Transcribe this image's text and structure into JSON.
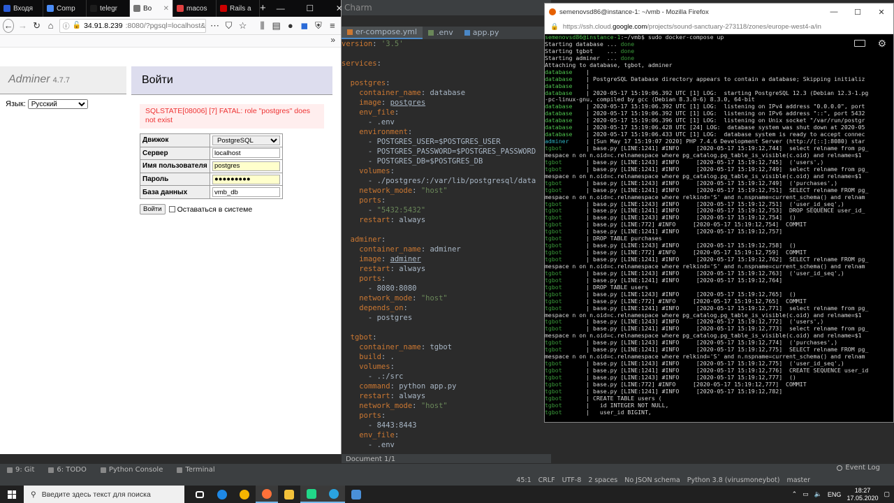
{
  "ide": {
    "title": "Charm",
    "tabs": [
      {
        "label": "er-compose.yml",
        "color": "#cc7832"
      },
      {
        "label": ".env",
        "color": "#6a8759"
      },
      {
        "label": "app.py",
        "color": "#4a88c7"
      }
    ],
    "code": [
      [
        [
          "k",
          "version"
        ],
        [
          "v",
          ": "
        ],
        [
          "s",
          "'3.5'"
        ]
      ],
      [],
      [
        [
          "k",
          "services"
        ],
        [
          "v",
          ":"
        ]
      ],
      [],
      [
        [
          "v",
          "  "
        ],
        [
          "k",
          "postgres"
        ],
        [
          "v",
          ":"
        ]
      ],
      [
        [
          "v",
          "    "
        ],
        [
          "k",
          "container_name"
        ],
        [
          "v",
          ": database"
        ]
      ],
      [
        [
          "v",
          "    "
        ],
        [
          "k",
          "image"
        ],
        [
          "v",
          ": "
        ],
        [
          "u",
          "postgres"
        ]
      ],
      [
        [
          "v",
          "    "
        ],
        [
          "k",
          "env_file"
        ],
        [
          "v",
          ":"
        ]
      ],
      [
        [
          "v",
          "      - .env"
        ]
      ],
      [
        [
          "v",
          "    "
        ],
        [
          "k",
          "environment"
        ],
        [
          "v",
          ":"
        ]
      ],
      [
        [
          "v",
          "      - POSTGRES_USER=$POSTGRES_USER"
        ]
      ],
      [
        [
          "v",
          "      - POSTGRES_PASSWORD=$POSTGRES_PASSWORD"
        ]
      ],
      [
        [
          "v",
          "      - POSTGRES_DB=$POSTGRES_DB"
        ]
      ],
      [
        [
          "v",
          "    "
        ],
        [
          "k",
          "volumes"
        ],
        [
          "v",
          ":"
        ]
      ],
      [
        [
          "v",
          "      - ./postgres/:/var/lib/postgresql/data"
        ]
      ],
      [
        [
          "v",
          "    "
        ],
        [
          "k",
          "network_mode"
        ],
        [
          "v",
          ": "
        ],
        [
          "s",
          "\"host\""
        ]
      ],
      [
        [
          "v",
          "    "
        ],
        [
          "k",
          "ports"
        ],
        [
          "v",
          ":"
        ]
      ],
      [
        [
          "v",
          "      - "
        ],
        [
          "s",
          "\"5432:5432\""
        ]
      ],
      [
        [
          "v",
          "    "
        ],
        [
          "k",
          "restart"
        ],
        [
          "v",
          ": always"
        ]
      ],
      [],
      [
        [
          "v",
          "  "
        ],
        [
          "k",
          "adminer"
        ],
        [
          "v",
          ":"
        ]
      ],
      [
        [
          "v",
          "    "
        ],
        [
          "k",
          "container_name"
        ],
        [
          "v",
          ": adminer"
        ]
      ],
      [
        [
          "v",
          "    "
        ],
        [
          "k",
          "image"
        ],
        [
          "v",
          ": "
        ],
        [
          "u",
          "adminer"
        ]
      ],
      [
        [
          "v",
          "    "
        ],
        [
          "k",
          "restart"
        ],
        [
          "v",
          ": always"
        ]
      ],
      [
        [
          "v",
          "    "
        ],
        [
          "k",
          "ports"
        ],
        [
          "v",
          ":"
        ]
      ],
      [
        [
          "v",
          "      - 8080:8080"
        ]
      ],
      [
        [
          "v",
          "    "
        ],
        [
          "k",
          "network_mode"
        ],
        [
          "v",
          ": "
        ],
        [
          "s",
          "\"host\""
        ]
      ],
      [
        [
          "v",
          "    "
        ],
        [
          "k",
          "depends_on"
        ],
        [
          "v",
          ":"
        ]
      ],
      [
        [
          "v",
          "      - postgres"
        ]
      ],
      [],
      [
        [
          "v",
          "  "
        ],
        [
          "k",
          "tgbot"
        ],
        [
          "v",
          ":"
        ]
      ],
      [
        [
          "v",
          "    "
        ],
        [
          "k",
          "container_name"
        ],
        [
          "v",
          ": tgbot"
        ]
      ],
      [
        [
          "v",
          "    "
        ],
        [
          "k",
          "build"
        ],
        [
          "v",
          ": ."
        ]
      ],
      [
        [
          "v",
          "    "
        ],
        [
          "k",
          "volumes"
        ],
        [
          "v",
          ":"
        ]
      ],
      [
        [
          "v",
          "      - .:/src"
        ]
      ],
      [
        [
          "v",
          "    "
        ],
        [
          "k",
          "command"
        ],
        [
          "v",
          ": python app.py"
        ]
      ],
      [
        [
          "v",
          "    "
        ],
        [
          "k",
          "restart"
        ],
        [
          "v",
          ": always"
        ]
      ],
      [
        [
          "v",
          "    "
        ],
        [
          "k",
          "network_mode"
        ],
        [
          "v",
          ": "
        ],
        [
          "s",
          "\"host\""
        ]
      ],
      [
        [
          "v",
          "    "
        ],
        [
          "k",
          "ports"
        ],
        [
          "v",
          ":"
        ]
      ],
      [
        [
          "v",
          "      - 8443:8443"
        ]
      ],
      [
        [
          "v",
          "    "
        ],
        [
          "k",
          "env_file"
        ],
        [
          "v",
          ":"
        ]
      ],
      [
        [
          "v",
          "      - .env"
        ]
      ]
    ],
    "status_left": "Document 1/1",
    "tools": [
      {
        "icon": "git-icon",
        "label": "9: Git"
      },
      {
        "icon": "todo-icon",
        "label": "6: TODO"
      },
      {
        "icon": "python-console-icon",
        "label": "Python Console"
      },
      {
        "icon": "terminal-icon",
        "label": "Terminal"
      }
    ],
    "event_log": "Event Log",
    "statusbar": [
      "45:1",
      "CRLF",
      "UTF-8",
      "2 spaces",
      "No JSON schema",
      "Python 3.8 (virusmoneybot)",
      "master"
    ]
  },
  "browser1": {
    "tabs": [
      {
        "label": "Входя",
        "color": "#2a5bd7",
        "active": false
      },
      {
        "label": "Comp",
        "color": "#4a8cf7",
        "active": false
      },
      {
        "label": "telegr",
        "color": "#1c1c1c",
        "active": false
      },
      {
        "label": "Bo",
        "color": "#777",
        "active": true
      },
      {
        "label": "macos",
        "color": "#e04040",
        "active": false
      },
      {
        "label": "Rails a",
        "color": "#c00",
        "active": false
      }
    ],
    "url_host": "34.91.8.239",
    "url_path": ":8080/?pgsql=localhost&u",
    "adminer": {
      "lang_label": "Язык:",
      "lang_value": "Русский",
      "title": "Adminer",
      "version": "4.7.7",
      "heading": "Войти",
      "error": "SQLSTATE[08006] [7] FATAL: role \"postgres\" does not exist",
      "fields": [
        {
          "label": "Движок",
          "value": "PostgreSQL",
          "type": "select"
        },
        {
          "label": "Сервер",
          "value": "localhost",
          "type": "text"
        },
        {
          "label": "Имя пользователя",
          "value": "postgres",
          "type": "autofill"
        },
        {
          "label": "Пароль",
          "value": "●●●●●●●●●",
          "type": "autofill"
        },
        {
          "label": "База данных",
          "value": "vmb_db",
          "type": "text"
        }
      ],
      "submit": "Войти",
      "remember": "Оставаться в системе"
    }
  },
  "browser2": {
    "title": "semenovsd86@instance-1: ~/vmb - Mozilla Firefox",
    "url_prefix": "https://ssh.cloud.",
    "url_host": "google.com",
    "url_path": "/projects/sound-sanctuary-273118/zones/europe-west4-a/in",
    "terminal": [
      [
        [
          "g",
          "semenovsd86@instance-1"
        ],
        [
          "w",
          ":~/vmb$ sudo docker-compose up"
        ]
      ],
      [
        [
          "w",
          "Starting database ... "
        ],
        [
          "d",
          "done"
        ]
      ],
      [
        [
          "w",
          "Starting tgbot    ... "
        ],
        [
          "d",
          "done"
        ]
      ],
      [
        [
          "w",
          "Starting adminer  ... "
        ],
        [
          "d",
          "done"
        ]
      ],
      [
        [
          "w",
          "Attaching to database, tgbot, adminer"
        ]
      ],
      [
        [
          "g",
          "database"
        ],
        [
          "w",
          "    |"
        ]
      ],
      [
        [
          "g",
          "database"
        ],
        [
          "w",
          "    | PostgreSQL Database directory appears to contain a database; Skipping initializ"
        ]
      ],
      [
        [
          "g",
          "database"
        ],
        [
          "w",
          "    |"
        ]
      ],
      [
        [
          "g",
          "database"
        ],
        [
          "w",
          "    | 2020-05-17 15:19:06.392 UTC [1] LOG:  starting PostgreSQL 12.3 (Debian 12.3-1.pg"
        ]
      ],
      [
        [
          "w",
          "-pc-linux-gnu, compiled by gcc (Debian 8.3.0-6) 8.3.0, 64-bit"
        ]
      ],
      [
        [
          "g",
          "database"
        ],
        [
          "w",
          "    | 2020-05-17 15:19:06.392 UTC [1] LOG:  listening on IPv4 address \"0.0.0.0\", port"
        ]
      ],
      [
        [
          "g",
          "database"
        ],
        [
          "w",
          "    | 2020-05-17 15:19:06.392 UTC [1] LOG:  listening on IPv6 address \"::\", port 5432"
        ]
      ],
      [
        [
          "g",
          "database"
        ],
        [
          "w",
          "    | 2020-05-17 15:19:06.396 UTC [1] LOG:  listening on Unix socket \"/var/run/postgr"
        ]
      ],
      [
        [
          "g",
          "database"
        ],
        [
          "w",
          "    | 2020-05-17 15:19:06.428 UTC [24] LOG:  database system was shut down at 2020-05"
        ]
      ],
      [
        [
          "g",
          "database"
        ],
        [
          "w",
          "    | 2020-05-17 15:19:06.433 UTC [1] LOG:  database system is ready to accept connec"
        ]
      ],
      [
        [
          "c",
          "adminer"
        ],
        [
          "w",
          "     | [Sun May 17 15:19:07 2020] PHP 7.4.6 Development Server (http://[::]:8080) star"
        ]
      ],
      [
        [
          "d",
          "tgbot"
        ],
        [
          "w",
          "       | base.py [LINE:1241] #INFO     [2020-05-17 15:19:12,744]  select relname from pg_"
        ]
      ],
      [
        [
          "w",
          "mespace n on n.oid=c.relnamespace where pg_catalog.pg_table_is_visible(c.oid) and relname=$1"
        ]
      ],
      [
        [
          "d",
          "tgbot"
        ],
        [
          "w",
          "       | base.py [LINE:1243] #INFO     [2020-05-17 15:19:12,745]  ('users',)"
        ]
      ],
      [
        [
          "d",
          "tgbot"
        ],
        [
          "w",
          "       | base.py [LINE:1241] #INFO     [2020-05-17 15:19:12,749]  select relname from pg_"
        ]
      ],
      [
        [
          "w",
          "mespace n on n.oid=c.relnamespace where pg_catalog.pg_table_is_visible(c.oid) and relname=$1"
        ]
      ],
      [
        [
          "d",
          "tgbot"
        ],
        [
          "w",
          "       | base.py [LINE:1243] #INFO     [2020-05-17 15:19:12,749]  ('purchases',)"
        ]
      ],
      [
        [
          "d",
          "tgbot"
        ],
        [
          "w",
          "       | base.py [LINE:1241] #INFO     [2020-05-17 15:19:12,751]  SELECT relname FROM pg_"
        ]
      ],
      [
        [
          "w",
          "mespace n on n.oid=c.relnamespace where relkind='S' and n.nspname=current_schema() and relnam"
        ]
      ],
      [
        [
          "d",
          "tgbot"
        ],
        [
          "w",
          "       | base.py [LINE:1243] #INFO     [2020-05-17 15:19:12,751]  ('user_id_seq',)"
        ]
      ],
      [
        [
          "d",
          "tgbot"
        ],
        [
          "w",
          "       | base.py [LINE:1241] #INFO     [2020-05-17 15:19:12,753]  DROP SEQUENCE user_id_"
        ]
      ],
      [
        [
          "d",
          "tgbot"
        ],
        [
          "w",
          "       | base.py [LINE:1243] #INFO     [2020-05-17 15:19:12,754]  ()"
        ]
      ],
      [
        [
          "d",
          "tgbot"
        ],
        [
          "w",
          "       | base.py [LINE:772] #INFO     [2020-05-17 15:19:12,754]  COMMIT"
        ]
      ],
      [
        [
          "d",
          "tgbot"
        ],
        [
          "w",
          "       | base.py [LINE:1241] #INFO     [2020-05-17 15:19:12,757]"
        ]
      ],
      [
        [
          "d",
          "tgbot"
        ],
        [
          "w",
          "       | DROP TABLE purchases"
        ]
      ],
      [
        [
          "d",
          "tgbot"
        ],
        [
          "w",
          "       | base.py [LINE:1243] #INFO     [2020-05-17 15:19:12,758]  ()"
        ]
      ],
      [
        [
          "d",
          "tgbot"
        ],
        [
          "w",
          "       | base.py [LINE:772] #INFO     [2020-05-17 15:19:12,759]  COMMIT"
        ]
      ],
      [
        [
          "d",
          "tgbot"
        ],
        [
          "w",
          "       | base.py [LINE:1241] #INFO     [2020-05-17 15:19:12,762]  SELECT relname FROM pg_"
        ]
      ],
      [
        [
          "w",
          "mespace n on n.oid=c.relnamespace where relkind='S' and n.nspname=current_schema() and relnam"
        ]
      ],
      [
        [
          "d",
          "tgbot"
        ],
        [
          "w",
          "       | base.py [LINE:1243] #INFO     [2020-05-17 15:19:12,763]  ('user_id_seq',)"
        ]
      ],
      [
        [
          "d",
          "tgbot"
        ],
        [
          "w",
          "       | base.py [LINE:1241] #INFO     [2020-05-17 15:19:12,764]"
        ]
      ],
      [
        [
          "d",
          "tgbot"
        ],
        [
          "w",
          "       | DROP TABLE users"
        ]
      ],
      [
        [
          "d",
          "tgbot"
        ],
        [
          "w",
          "       | base.py [LINE:1243] #INFO     [2020-05-17 15:19:12,765]  ()"
        ]
      ],
      [
        [
          "d",
          "tgbot"
        ],
        [
          "w",
          "       | base.py [LINE:772] #INFO     [2020-05-17 15:19:12,765]  COMMIT"
        ]
      ],
      [
        [
          "d",
          "tgbot"
        ],
        [
          "w",
          "       | base.py [LINE:1241] #INFO     [2020-05-17 15:19:12,771]  select relname from pg_"
        ]
      ],
      [
        [
          "w",
          "mespace n on n.oid=c.relnamespace where pg_catalog.pg_table_is_visible(c.oid) and relname=$1"
        ]
      ],
      [
        [
          "d",
          "tgbot"
        ],
        [
          "w",
          "       | base.py [LINE:1243] #INFO     [2020-05-17 15:19:12,772]  ('users',)"
        ]
      ],
      [
        [
          "d",
          "tgbot"
        ],
        [
          "w",
          "       | base.py [LINE:1241] #INFO     [2020-05-17 15:19:12,773]  select relname from pg_"
        ]
      ],
      [
        [
          "w",
          "mespace n on n.oid=c.relnamespace where pg_catalog.pg_table_is_visible(c.oid) and relname=$1"
        ]
      ],
      [
        [
          "d",
          "tgbot"
        ],
        [
          "w",
          "       | base.py [LINE:1243] #INFO     [2020-05-17 15:19:12,774]  ('purchases',)"
        ]
      ],
      [
        [
          "d",
          "tgbot"
        ],
        [
          "w",
          "       | base.py [LINE:1241] #INFO     [2020-05-17 15:19:12,775]  SELECT relname FROM pg_"
        ]
      ],
      [
        [
          "w",
          "mespace n on n.oid=c.relnamespace where relkind='S' and n.nspname=current_schema() and relnam"
        ]
      ],
      [
        [
          "d",
          "tgbot"
        ],
        [
          "w",
          "       | base.py [LINE:1243] #INFO     [2020-05-17 15:19:12,775]  ('user_id_seq',)"
        ]
      ],
      [
        [
          "d",
          "tgbot"
        ],
        [
          "w",
          "       | base.py [LINE:1241] #INFO     [2020-05-17 15:19:12,776]  CREATE SEQUENCE user_id"
        ]
      ],
      [
        [
          "d",
          "tgbot"
        ],
        [
          "w",
          "       | base.py [LINE:1243] #INFO     [2020-05-17 15:19:12,777]  ()"
        ]
      ],
      [
        [
          "d",
          "tgbot"
        ],
        [
          "w",
          "       | base.py [LINE:772] #INFO     [2020-05-17 15:19:12,777]  COMMIT"
        ]
      ],
      [
        [
          "d",
          "tgbot"
        ],
        [
          "w",
          "       | base.py [LINE:1241] #INFO     [2020-05-17 15:19:12,782]"
        ]
      ],
      [
        [
          "d",
          "tgbot"
        ],
        [
          "w",
          "       | CREATE TABLE users ("
        ]
      ],
      [
        [
          "d",
          "tgbot"
        ],
        [
          "w",
          "       |   id INTEGER NOT NULL,"
        ]
      ],
      [
        [
          "d",
          "tgbot"
        ],
        [
          "w",
          "       |   user_id BIGINT,"
        ]
      ]
    ]
  },
  "taskbar": {
    "search_placeholder": "Введите здесь текст для поиска",
    "apps": [
      {
        "icon": "task-view-icon",
        "color": "#fff",
        "active": false
      },
      {
        "icon": "edge-icon",
        "color": "#1e88e5",
        "active": false
      },
      {
        "icon": "chrome-icon",
        "color": "#f4b400",
        "active": false
      },
      {
        "icon": "firefox-icon",
        "color": "#ff7139",
        "active": true
      },
      {
        "icon": "explorer-icon",
        "color": "#f3c13a",
        "active": false
      },
      {
        "icon": "pycharm-icon",
        "color": "#21d789",
        "active": true
      },
      {
        "icon": "telegram-icon",
        "color": "#2aa3e0",
        "active": true
      },
      {
        "icon": "photos-icon",
        "color": "#4a90d9",
        "active": false
      }
    ],
    "lang": "ENG",
    "time": "18:27",
    "date": "17.05.2020"
  }
}
